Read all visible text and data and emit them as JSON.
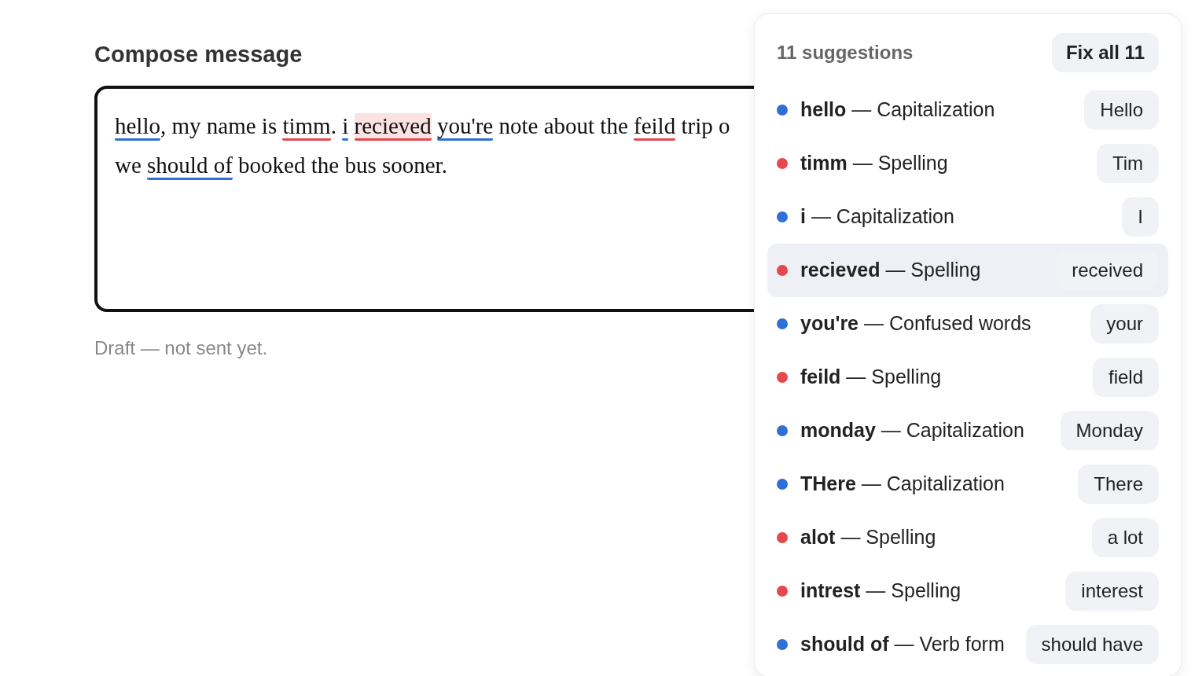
{
  "compose": {
    "title": "Compose message",
    "lines": [
      [
        {
          "text": "hello",
          "color": "#2f6fd6",
          "selected": false
        },
        {
          "text": ", my name is "
        },
        {
          "text": "timm",
          "color": "#e5484d",
          "selected": false
        },
        {
          "text": ". "
        },
        {
          "text": "i",
          "color": "#2f6fd6",
          "selected": false
        },
        {
          "text": "recieved",
          "color": "#e5484d",
          "selected": true
        },
        {
          "text": "you're",
          "color": "#2f6fd6",
          "selected": false
        },
        {
          "text": " note about the "
        },
        {
          "text": "feild",
          "color": "#e5484d",
          "selected": false
        },
        {
          "text": " trip o"
        }
      ],
      [
        {
          "text": "we "
        },
        {
          "text": "should of",
          "color": "#2f6fd6",
          "selected": false
        },
        {
          "text": " booked the bus sooner."
        }
      ]
    ],
    "status": "Draft — not sent yet."
  },
  "panel": {
    "count_label": "11 suggestions",
    "fix_all": "Fix all 11",
    "suggestions": [
      {
        "word": "hello",
        "category": "— Capitalization",
        "fix": "Hello",
        "color": "#2f6fd6",
        "selected": false
      },
      {
        "word": "timm",
        "category": "— Spelling",
        "fix": "Tim",
        "color": "#e5484d",
        "selected": false
      },
      {
        "word": "i",
        "category": "— Capitalization",
        "fix": "I",
        "color": "#2f6fd6",
        "selected": false
      },
      {
        "word": "recieved",
        "category": "— Spelling",
        "fix": "received",
        "color": "#e5484d",
        "selected": true
      },
      {
        "word": "you're",
        "category": "— Confused words",
        "fix": "your",
        "color": "#2f6fd6",
        "selected": false
      },
      {
        "word": "feild",
        "category": "— Spelling",
        "fix": "field",
        "color": "#e5484d",
        "selected": false
      },
      {
        "word": "monday",
        "category": "— Capitalization",
        "fix": "Monday",
        "color": "#2f6fd6",
        "selected": false
      },
      {
        "word": "THere",
        "category": "— Capitalization",
        "fix": "There",
        "color": "#2f6fd6",
        "selected": false
      },
      {
        "word": "alot",
        "category": "— Spelling",
        "fix": "a lot",
        "color": "#e5484d",
        "selected": false
      },
      {
        "word": "intrest",
        "category": "— Spelling",
        "fix": "interest",
        "color": "#e5484d",
        "selected": false
      },
      {
        "word": "should of",
        "category": "— Verb form",
        "fix": "should have",
        "color": "#2f6fd6",
        "selected": false
      }
    ]
  }
}
